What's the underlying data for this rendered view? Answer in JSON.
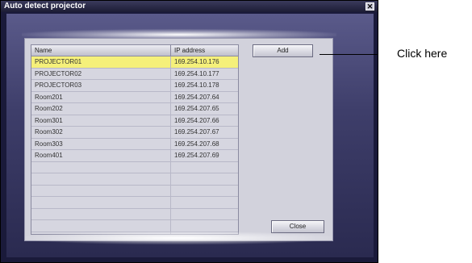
{
  "window": {
    "title": "Auto detect projector",
    "close_glyph": "✕"
  },
  "table": {
    "columns": [
      "Name",
      "IP address"
    ],
    "rows": [
      {
        "name": "PROJECTOR01",
        "ip": "169.254.10.176",
        "selected": true
      },
      {
        "name": "PROJECTOR02",
        "ip": "169.254.10.177"
      },
      {
        "name": "PROJECTOR03",
        "ip": "169.254.10.178"
      },
      {
        "name": "Room201",
        "ip": "169.254.207.64"
      },
      {
        "name": "Room202",
        "ip": "169.254.207.65"
      },
      {
        "name": "Room301",
        "ip": "169.254.207.66"
      },
      {
        "name": "Room302",
        "ip": "169.254.207.67"
      },
      {
        "name": "Room303",
        "ip": "169.254.207.68"
      },
      {
        "name": "Room401",
        "ip": "169.254.207.69"
      },
      {
        "name": "",
        "ip": ""
      },
      {
        "name": "",
        "ip": ""
      },
      {
        "name": "",
        "ip": ""
      },
      {
        "name": "",
        "ip": ""
      },
      {
        "name": "",
        "ip": ""
      },
      {
        "name": "",
        "ip": ""
      },
      {
        "name": "",
        "ip": ""
      }
    ]
  },
  "buttons": {
    "add_label": "Add",
    "close_label": "Close"
  },
  "callout": {
    "text": "Click here"
  },
  "colors": {
    "selected_row": "#f5f07a",
    "window_bg": "#1a1a3a"
  }
}
